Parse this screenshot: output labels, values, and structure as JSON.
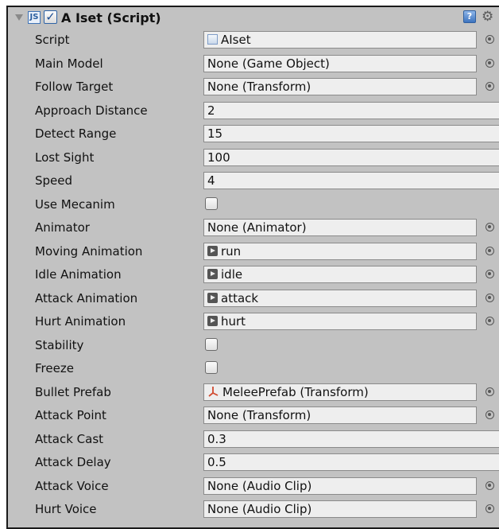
{
  "component": {
    "title": "A Iset (Script)",
    "enabled": true,
    "js_badge": "JS",
    "help_glyph": "?",
    "gear_glyph": "⚙"
  },
  "fields": [
    {
      "label": "Script",
      "kind": "object",
      "value": "AIset",
      "icon": "script-file-icon"
    },
    {
      "label": "Main Model",
      "kind": "object",
      "value": "None (Game Object)"
    },
    {
      "label": "Follow Target",
      "kind": "object",
      "value": "None (Transform)"
    },
    {
      "label": "Approach Distance",
      "kind": "number",
      "value": "2"
    },
    {
      "label": "Detect Range",
      "kind": "number",
      "value": "15"
    },
    {
      "label": "Lost Sight",
      "kind": "number",
      "value": "100"
    },
    {
      "label": "Speed",
      "kind": "number",
      "value": "4"
    },
    {
      "label": "Use Mecanim",
      "kind": "checkbox",
      "checked": false
    },
    {
      "label": "Animator",
      "kind": "object",
      "value": "None (Animator)"
    },
    {
      "label": "Moving Animation",
      "kind": "object",
      "value": "run",
      "icon": "animation-clip-icon"
    },
    {
      "label": "Idle Animation",
      "kind": "object",
      "value": "idle",
      "icon": "animation-clip-icon"
    },
    {
      "label": "Attack Animation",
      "kind": "object",
      "value": "attack",
      "icon": "animation-clip-icon"
    },
    {
      "label": "Hurt Animation",
      "kind": "object",
      "value": "hurt",
      "icon": "animation-clip-icon"
    },
    {
      "label": "Stability",
      "kind": "checkbox",
      "checked": false
    },
    {
      "label": "Freeze",
      "kind": "checkbox",
      "checked": false
    },
    {
      "label": "Bullet Prefab",
      "kind": "object",
      "value": "MeleePrefab (Transform)",
      "icon": "transform-prefab-icon"
    },
    {
      "label": "Attack Point",
      "kind": "object",
      "value": "None (Transform)"
    },
    {
      "label": "Attack Cast",
      "kind": "number",
      "value": "0.3"
    },
    {
      "label": "Attack Delay",
      "kind": "number",
      "value": "0.5"
    },
    {
      "label": "Attack Voice",
      "kind": "object",
      "value": "None (Audio Clip)"
    },
    {
      "label": "Hurt Voice",
      "kind": "object",
      "value": "None (Audio Clip)"
    }
  ]
}
